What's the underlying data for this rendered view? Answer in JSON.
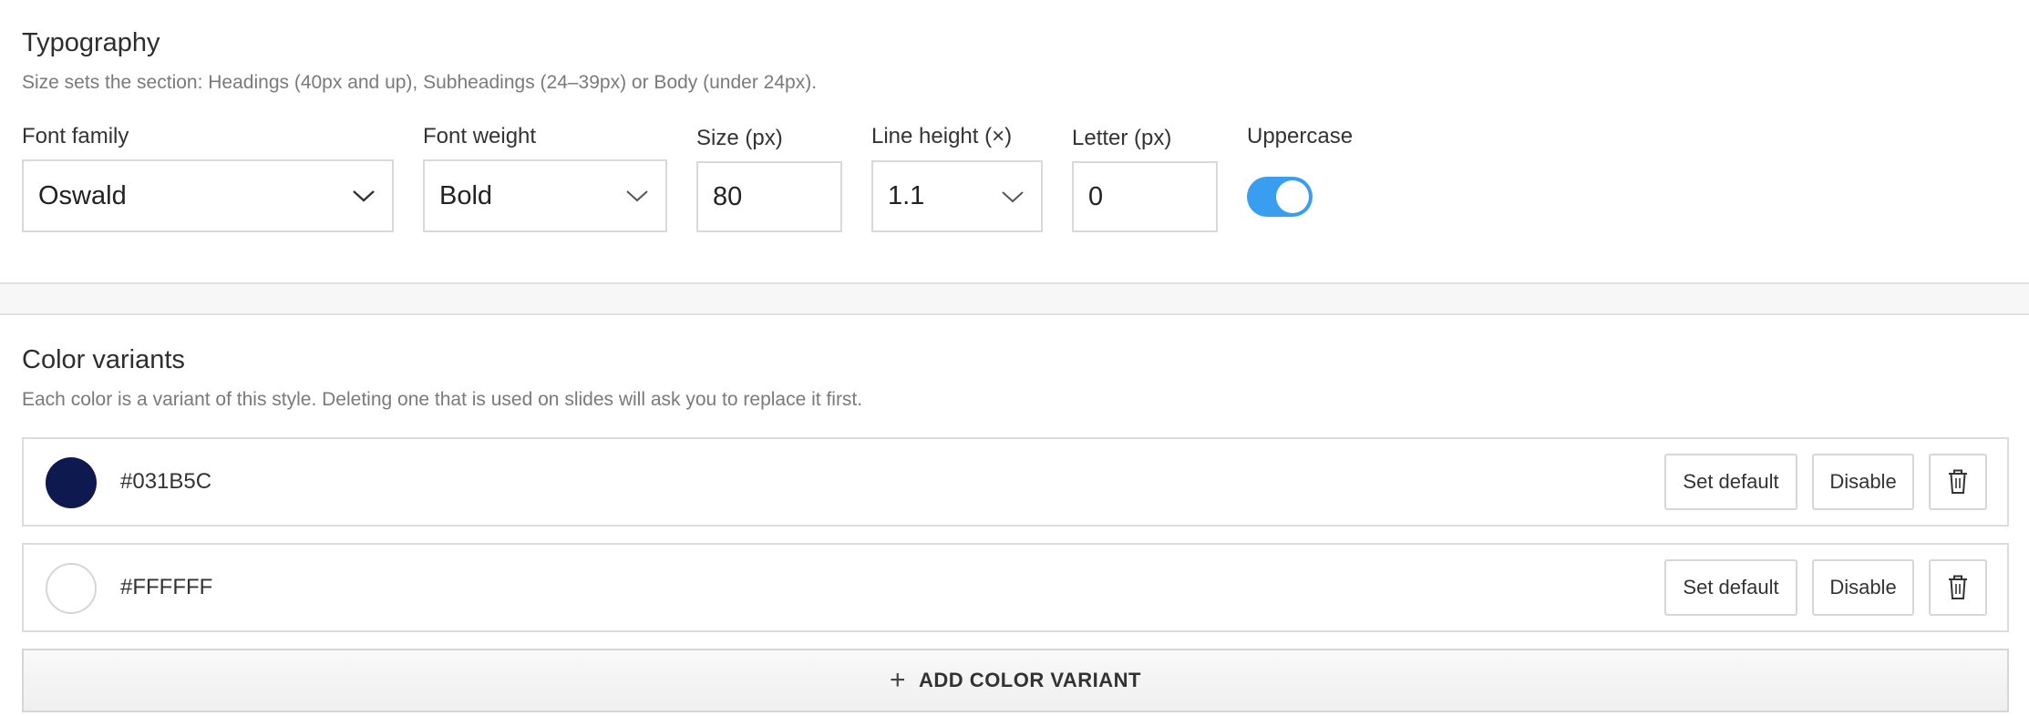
{
  "typography": {
    "title": "Typography",
    "description": "Size sets the section: Headings (40px and up), Subheadings (24–39px) or Body (under 24px).",
    "fields": {
      "font_family": {
        "label": "Font family",
        "value": "Oswald"
      },
      "font_weight": {
        "label": "Font weight",
        "value": "Bold"
      },
      "size": {
        "label": "Size (px)",
        "value": "80"
      },
      "line_height": {
        "label": "Line height (×)",
        "value": "1.1"
      },
      "letter": {
        "label": "Letter (px)",
        "value": "0"
      },
      "uppercase": {
        "label": "Uppercase",
        "enabled": true
      }
    }
  },
  "color_variants": {
    "title": "Color variants",
    "description": "Each color is a variant of this style. Deleting one that is used on slides will ask you to replace it first.",
    "items": [
      {
        "hex": "#031B5C",
        "set_default_label": "Set default",
        "disable_label": "Disable"
      },
      {
        "hex": "#FFFFFF",
        "set_default_label": "Set default",
        "disable_label": "Disable"
      }
    ],
    "add_label": "ADD COLOR VARIANT"
  },
  "colors": {
    "accent": "#3A9EF0",
    "swatch_navy": "#0E1A4F"
  },
  "icons": {
    "dropdown": "chevron-down-icon",
    "delete": "trash-icon",
    "add": "plus-icon"
  }
}
